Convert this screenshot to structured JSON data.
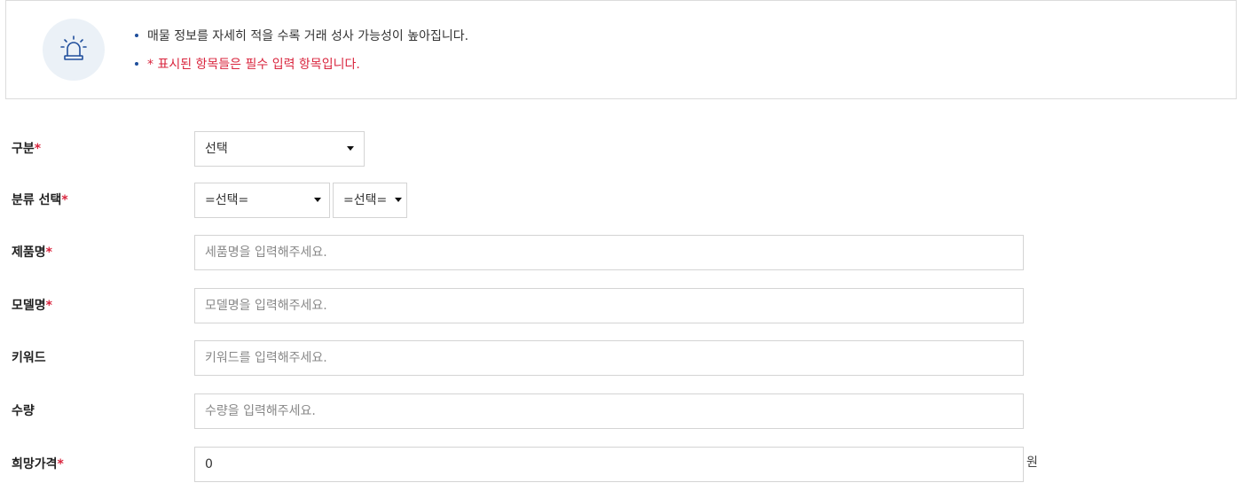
{
  "notice": {
    "icon": "siren-icon",
    "lines": [
      "매물 정보를 자세히 적을 수록 거래 성사 가능성이 높아집니다.",
      "* 표시된 항목들은 필수 입력 항목입니다."
    ]
  },
  "colors": {
    "accent": "#1f4e9c",
    "required": "#d9243d",
    "icon_bg": "#ebf1f7",
    "border": "#d4d4d4"
  },
  "form": {
    "category": {
      "label": "구분",
      "required_mark": "*",
      "value": "선택"
    },
    "classification": {
      "label": "분류 선택",
      "required_mark": "*",
      "first_value": "=선택=",
      "second_value": "=선택="
    },
    "product_name": {
      "label": "제품명",
      "required_mark": "*",
      "placeholder": "세품명을 입력해주세요."
    },
    "model_name": {
      "label": "모델명",
      "required_mark": "*",
      "placeholder": "모델명을 입력해주세요."
    },
    "keyword": {
      "label": "키워드",
      "placeholder": "키워드를 입력해주세요."
    },
    "quantity": {
      "label": "수량",
      "placeholder": "수량을 입력해주세요."
    },
    "desired_price": {
      "label": "희망가격",
      "required_mark": "*",
      "value": "0",
      "unit": "원"
    }
  }
}
